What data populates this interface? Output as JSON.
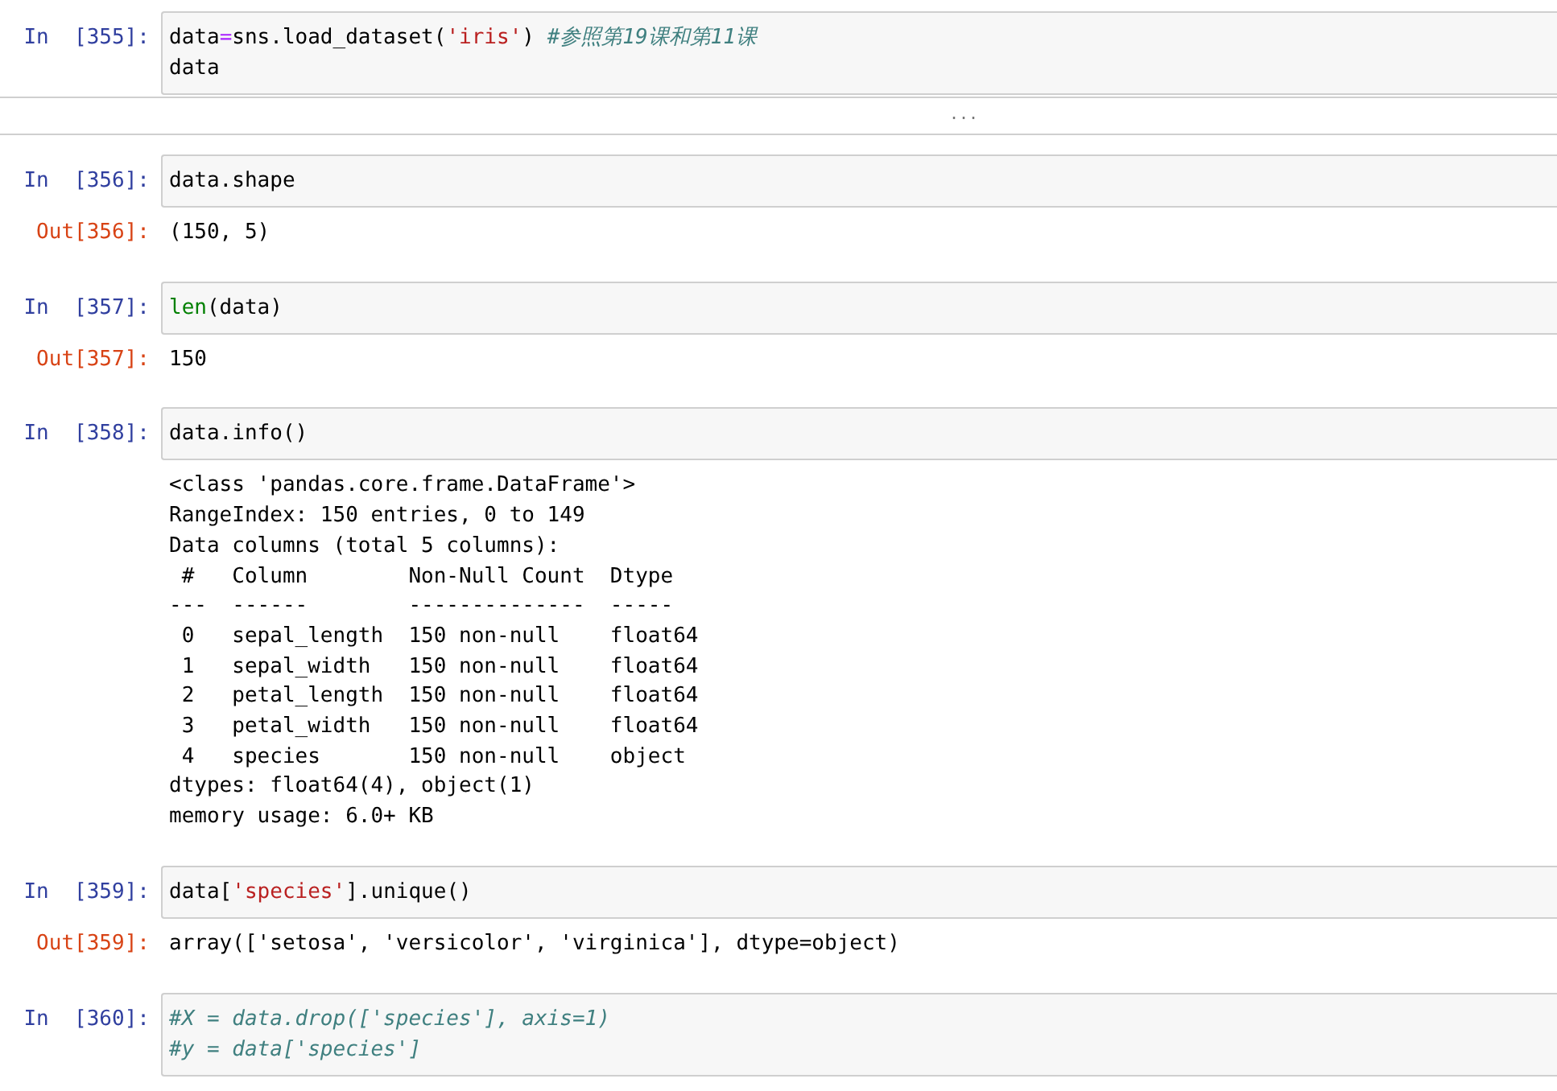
{
  "cells": [
    {
      "prompt": "In  [355]:",
      "lines": [
        [
          {
            "kind": "text",
            "text": "data"
          },
          {
            "kind": "operator",
            "text": "="
          },
          {
            "kind": "text",
            "text": "sns.load_dataset("
          },
          {
            "kind": "string",
            "text": "'iris'"
          },
          {
            "kind": "text",
            "text": ") "
          },
          {
            "kind": "comment",
            "text": "#参照第19课和第11课"
          }
        ],
        [
          {
            "kind": "text",
            "text": "data"
          }
        ]
      ],
      "collapsed_marker": "..."
    },
    {
      "prompt": "In  [356]:",
      "lines": [
        [
          {
            "kind": "text",
            "text": "data.shape"
          }
        ]
      ],
      "output": {
        "prompt": "Out[356]:",
        "lines": [
          "(150, 5)"
        ]
      }
    },
    {
      "prompt": "In  [357]:",
      "lines": [
        [
          {
            "kind": "builtin",
            "text": "len"
          },
          {
            "kind": "text",
            "text": "(data)"
          }
        ]
      ],
      "output": {
        "prompt": "Out[357]:",
        "lines": [
          "150"
        ]
      }
    },
    {
      "prompt": "In  [358]:",
      "lines": [
        [
          {
            "kind": "text",
            "text": "data.info()"
          }
        ]
      ],
      "output": {
        "lines": [
          "<class 'pandas.core.frame.DataFrame'>",
          "RangeIndex: 150 entries, 0 to 149",
          "Data columns (total 5 columns):",
          " #   Column        Non-Null Count  Dtype  ",
          "---  ------        --------------  -----  ",
          " 0   sepal_length  150 non-null    float64",
          " 1   sepal_width   150 non-null    float64",
          " 2   petal_length  150 non-null    float64",
          " 3   petal_width   150 non-null    float64",
          " 4   species       150 non-null    object ",
          "dtypes: float64(4), object(1)",
          "memory usage: 6.0+ KB"
        ]
      }
    },
    {
      "prompt": "In  [359]:",
      "lines": [
        [
          {
            "kind": "text",
            "text": "data["
          },
          {
            "kind": "string",
            "text": "'species'"
          },
          {
            "kind": "text",
            "text": "].unique()"
          }
        ]
      ],
      "output": {
        "prompt": "Out[359]:",
        "lines": [
          "array(['setosa', 'versicolor', 'virginica'], dtype=object)"
        ]
      }
    },
    {
      "prompt": "In  [360]:",
      "lines": [
        [
          {
            "kind": "comment",
            "text": "#X = data.drop(['species'], axis=1)"
          }
        ],
        [
          {
            "kind": "comment",
            "text": "#y = data['species']"
          }
        ]
      ]
    }
  ]
}
